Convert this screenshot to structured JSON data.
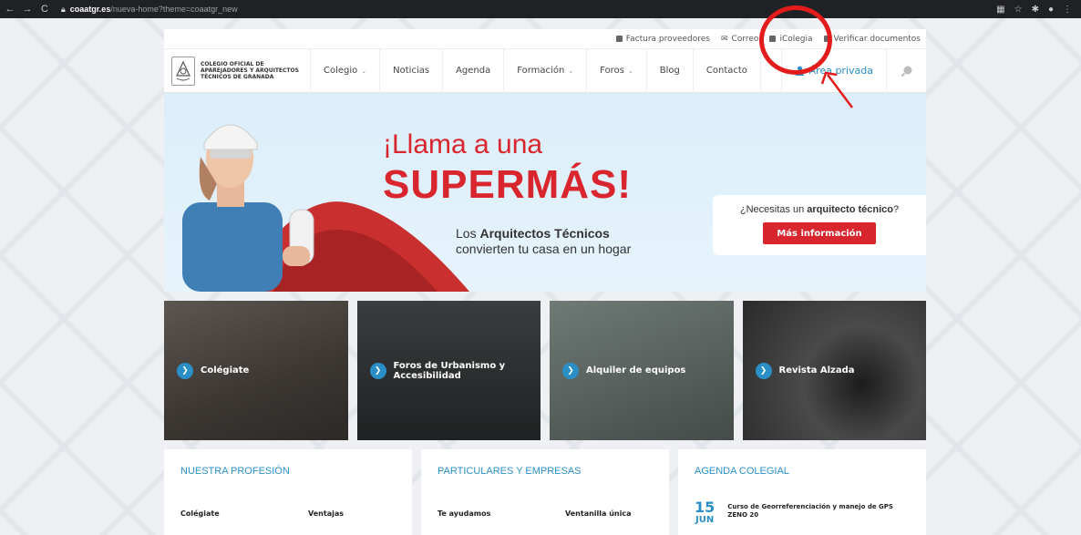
{
  "browser": {
    "url_host": "coaatgr.es",
    "url_path": "/nueva-home?theme=coaatgr_new"
  },
  "topbar": {
    "items": [
      "Factura proveedores",
      "Correo",
      "iColegia",
      "Verificar documentos"
    ]
  },
  "logo": {
    "text": "COLEGIO OFICIAL DE APAREJADORES Y ARQUITECTOS TÉCNICOS DE GRANADA"
  },
  "menu": {
    "items": [
      "Colegio",
      "Noticias",
      "Agenda",
      "Formación",
      "Foros",
      "Blog",
      "Contacto"
    ],
    "private_area": "Área privada"
  },
  "hero": {
    "headline1": "¡Llama a una",
    "headline2": "SUPERMÁS!",
    "sub_line1_pre": "Los ",
    "sub_line1_bold": "Arquitectos Técnicos",
    "sub_line2": "convierten tu casa en un hogar",
    "question_pre": "¿Necesitas un ",
    "question_bold": "arquitecto técnico",
    "question_post": "?",
    "cta": "Más información"
  },
  "tiles": [
    {
      "label": "Colégiate"
    },
    {
      "label": "Foros de Urbanismo y Accesibilidad"
    },
    {
      "label": "Alquiler de equipos"
    },
    {
      "label": "Revista Alzada"
    }
  ],
  "columns": {
    "profesion": {
      "title": "NUESTRA PROFESIÓN",
      "left": "Colégiate",
      "right": "Ventajas"
    },
    "particulares": {
      "title": "PARTICULARES Y EMPRESAS",
      "left": "Te ayudamos",
      "right": "Ventanilla única"
    },
    "agenda": {
      "title": "AGENDA COLEGIAL",
      "day": "15",
      "month": "JUN",
      "event": "Curso de Georreferenciación y manejo de GPS ZENO 20"
    }
  },
  "colors": {
    "accent_red": "#d9262e",
    "accent_blue": "#2a8fc7",
    "annotation_red": "#e31b1b"
  }
}
